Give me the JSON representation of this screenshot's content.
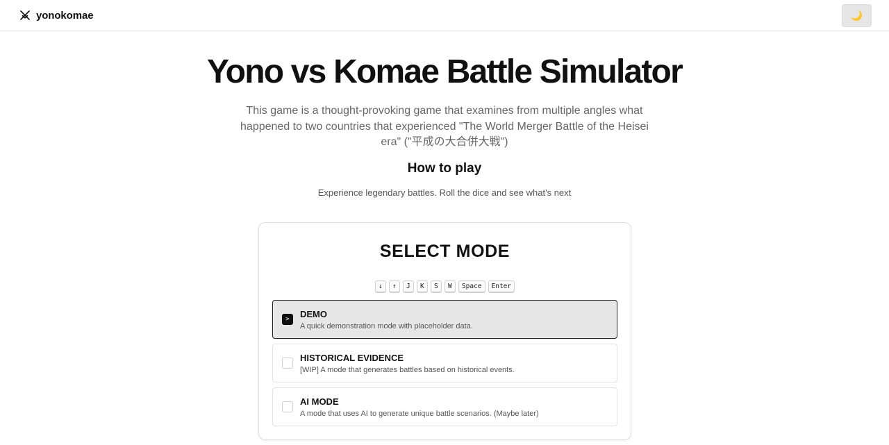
{
  "header": {
    "brand_icon": "crossed-swords-icon",
    "brand_name": "yonokomae",
    "theme_toggle_icon": "moon-icon",
    "theme_toggle_glyph": "🌙"
  },
  "hero": {
    "title": "Yono vs Komae Battle Simulator",
    "description": "This game is a thought-provoking game that examines from multiple angles what happened to two countries that experienced \"The World Merger Battle of the Heisei era\" (\"平成の大合併大戦\")",
    "howto_heading": "How to play",
    "tagline": "Experience legendary battles. Roll the dice and see what's next"
  },
  "mode_select": {
    "title": "SELECT MODE",
    "keys": [
      "↓",
      "↑",
      "J",
      "K",
      "S",
      "W",
      "Space",
      "Enter"
    ],
    "modes": [
      {
        "name": "DEMO",
        "description": "A quick demonstration mode with placeholder data.",
        "selected": true,
        "indicator": ">"
      },
      {
        "name": "HISTORICAL EVIDENCE",
        "description": "[WIP] A mode that generates battles based on historical events.",
        "selected": false,
        "indicator": ""
      },
      {
        "name": "AI MODE",
        "description": "A mode that uses AI to generate unique battle scenarios. (Maybe later)",
        "selected": false,
        "indicator": ""
      }
    ]
  }
}
